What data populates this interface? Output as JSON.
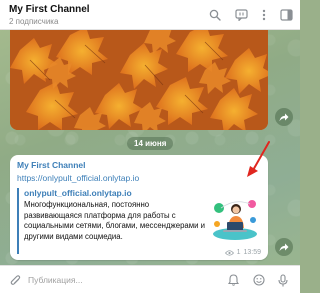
{
  "header": {
    "title": "My First Channel",
    "subtitle": "2 подписчика",
    "icons": [
      "search-icon",
      "live-chat-icon",
      "more-icon",
      "sidebar-icon"
    ]
  },
  "date_separator": "14 июня",
  "message": {
    "author": "My First Channel",
    "link": "https://onlypult_official.onlytap.io",
    "preview": {
      "site": "onlypult_official.onlytap.io",
      "description": "Многофункциональная, постоянно развивающаяся платформа для работы с социальными сетями, блогами, мессенджерами и другими видами соцмедиа."
    },
    "views": "1",
    "time": "13:59"
  },
  "input": {
    "placeholder": "Публикация..."
  },
  "colors": {
    "link": "#3d7fb8",
    "annotation_arrow": "#e0261f",
    "photo": "#c4651c"
  }
}
